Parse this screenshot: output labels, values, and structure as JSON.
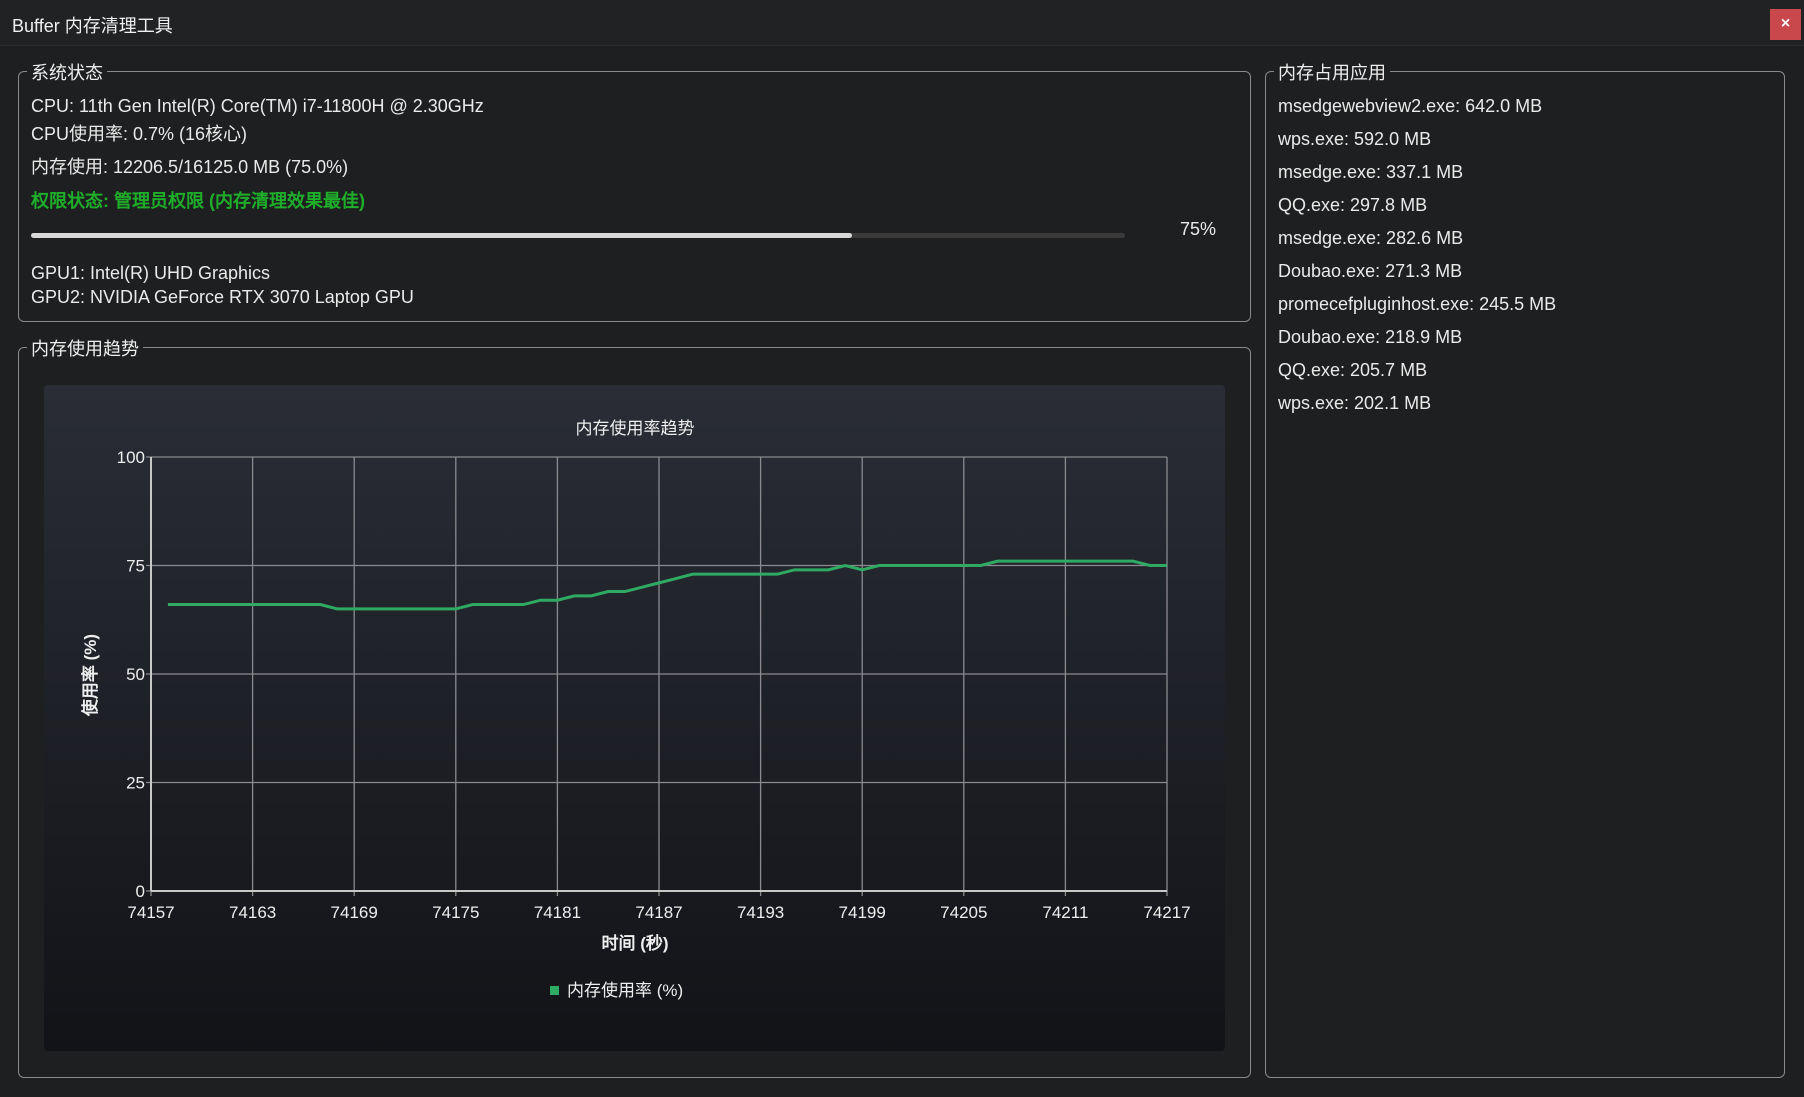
{
  "window": {
    "title": "Buffer 内存清理工具",
    "close_label": "×"
  },
  "system": {
    "group_label": "系统状态",
    "cpu": "CPU: 11th Gen Intel(R) Core(TM) i7-11800H @ 2.30GHz",
    "cpu_usage": "CPU使用率: 0.7% (16核心)",
    "memory": "内存使用: 12206.5/16125.0 MB (75.0%)",
    "permission": "权限状态: 管理员权限 (内存清理效果最佳)",
    "progress_percent": 75,
    "progress_label": "75%",
    "gpu1": "GPU1: Intel(R) UHD Graphics",
    "gpu2": "GPU2: NVIDIA GeForce RTX 3070 Laptop GPU",
    "permission_color": "#1fae2a"
  },
  "trend": {
    "group_label": "内存使用趋势"
  },
  "apps": {
    "group_label": "内存占用应用",
    "items": [
      "msedgewebview2.exe: 642.0 MB",
      "wps.exe: 592.0 MB",
      "msedge.exe: 337.1 MB",
      "QQ.exe: 297.8 MB",
      "msedge.exe: 282.6 MB",
      "Doubao.exe: 271.3 MB",
      "promecefpluginhost.exe: 245.5 MB",
      "Doubao.exe: 218.9 MB",
      "QQ.exe: 205.7 MB",
      "wps.exe: 202.1 MB"
    ]
  },
  "chart_data": {
    "type": "line",
    "title": "内存使用率趋势",
    "xlabel": "时间 (秒)",
    "ylabel": "使用率 (%)",
    "xlim": [
      74157,
      74217
    ],
    "ylim": [
      0,
      100
    ],
    "xticks": [
      "74157",
      "74163",
      "74169",
      "74175",
      "74181",
      "74187",
      "74193",
      "74199",
      "74205",
      "74211",
      "74217"
    ],
    "yticks": [
      "0",
      "25",
      "50",
      "75",
      "100"
    ],
    "grid": true,
    "legend_position": "bottom",
    "series": [
      {
        "name": "内存使用率 (%)",
        "color": "#2eaa62",
        "x_start": 74158,
        "values": [
          66,
          66,
          66,
          66,
          66,
          66,
          66,
          66,
          66,
          66,
          65,
          65,
          65,
          65,
          65,
          65,
          65,
          65,
          66,
          66,
          66,
          66,
          67,
          67,
          68,
          68,
          69,
          69,
          70,
          71,
          72,
          73,
          73,
          73,
          73,
          73,
          73,
          74,
          74,
          74,
          75,
          74,
          75,
          75,
          75,
          75,
          75,
          75,
          75,
          76,
          76,
          76,
          76,
          76,
          76,
          76,
          76,
          76,
          75,
          75
        ]
      }
    ]
  }
}
